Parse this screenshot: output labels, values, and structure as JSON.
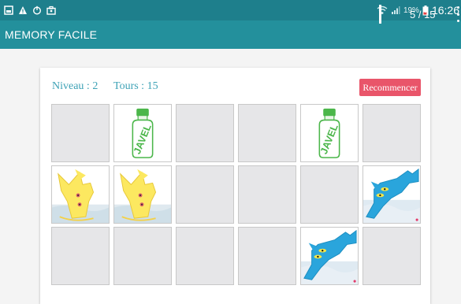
{
  "status_bar": {
    "battery_pct": "19%",
    "time": "16:26",
    "icons": [
      "gallery-icon",
      "warning-icon",
      "power-icon",
      "briefcase-icon",
      "wifi-icon",
      "signal-icon",
      "battery-icon"
    ]
  },
  "app_bar": {
    "title": "MEMORY FACILE",
    "progress": "5 / 15",
    "menu_icon": "overflow-menu-icon"
  },
  "game": {
    "level_label": "Niveau : 2",
    "turns_label": "Tours : 15",
    "restart_label": "Recommencer",
    "grid": [
      [
        "hidden",
        "bottle",
        "hidden",
        "hidden",
        "bottle",
        "hidden"
      ],
      [
        "yellow",
        "yellow",
        "hidden",
        "hidden",
        "hidden",
        "blue"
      ],
      [
        "hidden",
        "hidden",
        "hidden",
        "hidden",
        "blue",
        "hidden"
      ]
    ],
    "bottle_text": "JAVEL"
  },
  "colors": {
    "status_bar": "#1e7f8c",
    "app_bar": "#23909c",
    "accent_text": "#3ea2b6",
    "restart_button": "#e9556a",
    "tile_back": "#e6e6e8"
  }
}
